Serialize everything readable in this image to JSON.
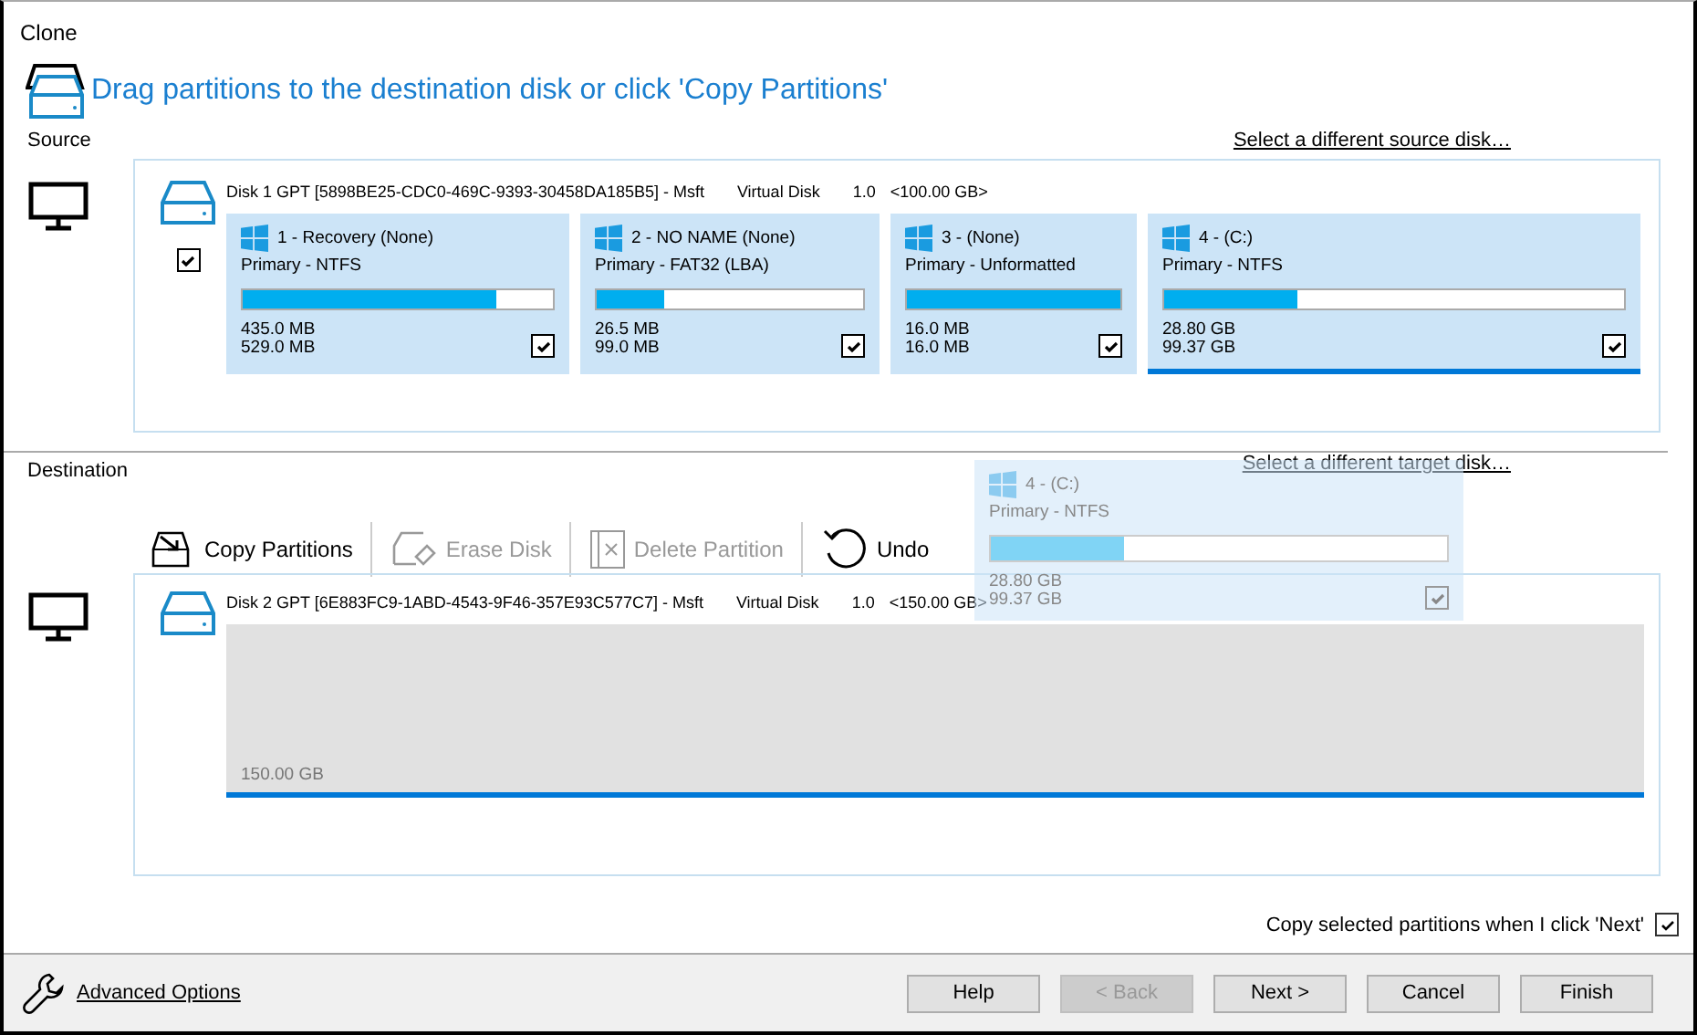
{
  "window": {
    "title": "Clone"
  },
  "instruction": "Drag partitions to the destination disk or click 'Copy Partitions'",
  "source": {
    "label": "Source",
    "link": "Select a different source disk…",
    "disk": {
      "header": "Disk 1 GPT [5898BE25-CDC0-469C-9393-30458DA185B5] - Msft",
      "model": "Virtual Disk",
      "version": "1.0",
      "size": "<100.00 GB>",
      "checked": true,
      "partitions": [
        {
          "title": "1 - Recovery (None)",
          "type": "Primary - NTFS",
          "level": 0.82,
          "used": "435.0 MB",
          "total": "529.0 MB",
          "checked": true,
          "selected": false
        },
        {
          "title": "2 - NO NAME (None)",
          "type": "Primary - FAT32 (LBA)",
          "level": 0.25,
          "used": "26.5 MB",
          "total": "99.0 MB",
          "checked": true,
          "selected": false
        },
        {
          "title": "3 -  (None)",
          "type": "Primary - Unformatted",
          "level": 1.0,
          "used": "16.0 MB",
          "total": "16.0 MB",
          "checked": true,
          "selected": false
        },
        {
          "title": "4 -  (C:)",
          "type": "Primary - NTFS",
          "level": 0.29,
          "used": "28.80 GB",
          "total": "99.37 GB",
          "checked": true,
          "selected": true
        }
      ]
    }
  },
  "destination": {
    "label": "Destination",
    "link": "Select a different target disk…",
    "toolbar": [
      {
        "kind": "copy",
        "label": "Copy Partitions",
        "disabled": false
      },
      {
        "kind": "erase",
        "label": "Erase Disk",
        "disabled": true
      },
      {
        "kind": "delete",
        "label": "Delete Partition",
        "disabled": true
      },
      {
        "kind": "undo",
        "label": "Undo",
        "disabled": false
      }
    ],
    "disk": {
      "header": "Disk 2 GPT [6E883FC9-1ABD-4543-9F46-357E93C577C7] - Msft",
      "model": "Virtual Disk",
      "version": "1.0",
      "size": "<150.00 GB>",
      "unallocated": "150.00 GB"
    },
    "drag_preview": {
      "title": "4 -  (C:)",
      "type": "Primary - NTFS",
      "level": 0.29,
      "used": "28.80 GB",
      "total": "99.37 GB",
      "checked": true
    }
  },
  "copy_on_next": {
    "label": "Copy selected partitions when I click 'Next'",
    "checked": true
  },
  "footer": {
    "advanced_options": "Advanced Options",
    "buttons": [
      {
        "label": "Help",
        "disabled": false
      },
      {
        "label": "< Back",
        "disabled": true
      },
      {
        "label": "Next >",
        "disabled": false
      },
      {
        "label": "Cancel",
        "disabled": false
      },
      {
        "label": "Finish",
        "disabled": false
      }
    ]
  }
}
